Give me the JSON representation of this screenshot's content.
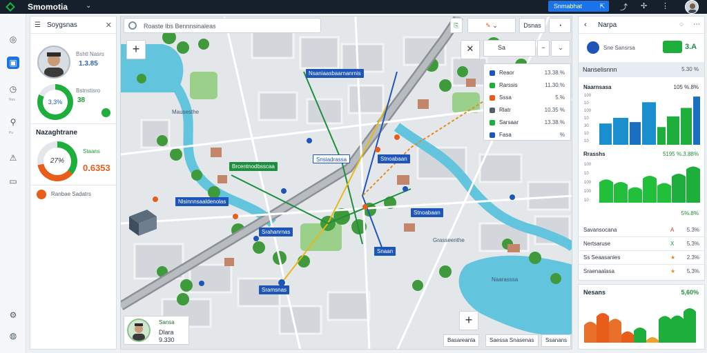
{
  "app": {
    "title": "Smomotia"
  },
  "topbar": {
    "primary_button": "Snmabhat",
    "user_icon": "avatar"
  },
  "rail": {
    "items": [
      "Map",
      "Layers",
      "Time",
      "Gis",
      "Alert",
      "Screen"
    ],
    "labels": [
      "Res",
      "Pu"
    ]
  },
  "left_panel": {
    "title": "Soygsnas",
    "profile": {
      "label": "Bshtl Nasrs",
      "value": "1.3.85"
    },
    "ring1": {
      "center": "3,3%",
      "label": "Bstnstisro",
      "value": "38",
      "percent": 0.82,
      "color": "#1eae3c"
    },
    "section_title": "Nazaghtrane",
    "ring2": {
      "center": "27%",
      "label": "Staans",
      "value": "0.6353",
      "percent": 0.72
    },
    "alert": "Ranbae Sadatrs"
  },
  "map": {
    "search": "Roaste Ibs Bennnsinaleas",
    "ctrl_a": "Sa",
    "ctrl_b": "Dsnas",
    "layers": [
      {
        "name": "Reaor",
        "value": "13.38.%",
        "color": "#1d56b8"
      },
      {
        "name": "Rarssis",
        "value": "11.30.%",
        "color": "#1eae3c"
      },
      {
        "name": "Sssa",
        "value": "5.%",
        "color": "#e85d1a"
      },
      {
        "name": "Rlatr",
        "value": "10.35 %",
        "color": "#55606b"
      },
      {
        "name": "Sarsaar",
        "value": "13.38.%",
        "color": "#1eae3c"
      },
      {
        "name": "Fasa",
        "value": "%",
        "color": "#1d56b8"
      }
    ],
    "labels": [
      "Nsaniaasbaarnanrnis",
      "Snsiadrassa",
      "Stnoabaan",
      "Brcentnodbsscaa",
      "Nlsinnnsaaldenolas",
      "Srahanrnas",
      "Snaan",
      "Sramsnas"
    ],
    "places": [
      "Mausesthe",
      "Grasseenthe",
      "Naarasssa"
    ],
    "card": {
      "t1": "Sansa",
      "t2": "Dlara",
      "t3": "9.330"
    },
    "bottom": [
      "Basareanla",
      "Saessa Snasenas",
      "Ssanans"
    ]
  },
  "right_panel": {
    "title": "Narpa",
    "summary": "Sne Sansrsa",
    "summary_value": "3.A",
    "band_title": "Nanselisnnn",
    "band_value": "5.30 %",
    "chart1": {
      "title": "Naarnsasa",
      "value": "105 %.8%",
      "yticks": [
        "100",
        "10",
        "100",
        "10",
        "30",
        "10",
        "10"
      ],
      "values": [
        30,
        38,
        32,
        60,
        25,
        40,
        52,
        68
      ]
    },
    "chart2": {
      "title": "Rrasshs",
      "value": "5195 %.3.88%",
      "values": [
        45,
        40,
        30,
        52,
        38,
        56,
        70
      ]
    },
    "chart2_yticks": [
      "100",
      "10",
      "100",
      "100",
      "10"
    ],
    "chart2_foot": "5%.8%",
    "rows": [
      {
        "name": "Savansocana",
        "mark": "A",
        "value": "5.3%",
        "color": "#c0392b"
      },
      {
        "name": "Nertsaruse",
        "mark": "X",
        "value": "5.3%",
        "color": "#1e8e3e"
      },
      {
        "name": "Ss Seaasanles",
        "mark": "★",
        "value": "2.3%",
        "color": "#e58a1a"
      },
      {
        "name": "Sraenaalasa",
        "mark": "★",
        "value": "5.3%",
        "color": "#e58a1a"
      }
    ]
  },
  "right_panel_2": {
    "title": "Nesans",
    "value": "5,60%",
    "values": [
      42,
      60,
      48,
      22,
      30,
      10,
      54,
      55,
      70
    ]
  }
}
